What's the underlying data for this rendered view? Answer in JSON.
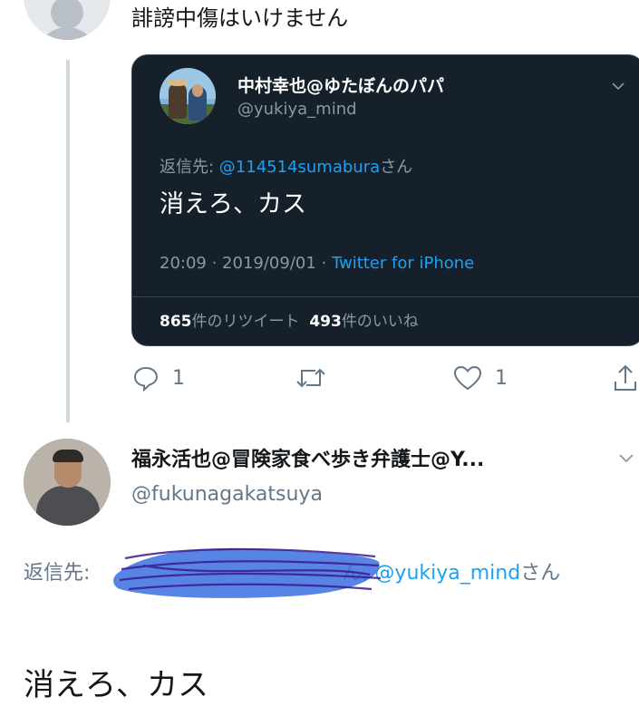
{
  "tweet1": {
    "text": "誹謗中傷はいけません",
    "avatar": "default-profile-avatar"
  },
  "quoted": {
    "display_name": "中村幸也@ゆたぼんのパパ",
    "handle": "@yukiya_mind",
    "reply_label": "返信先: ",
    "reply_mention": "@114514sumabura",
    "reply_suffix": "さん",
    "text": "消えろ、カス",
    "time": "20:09 · 2019/09/01 · ",
    "source": "Twitter for iPhone",
    "retweets_count": "865",
    "retweets_label": "件のリツイート",
    "likes_count": "493",
    "likes_label": "件のいいね",
    "colors": {
      "background": "#15202b",
      "accent": "#1da1f2",
      "muted": "#8899a6"
    }
  },
  "actions": {
    "reply_count": "1",
    "like_count": "1",
    "icons": [
      "reply-icon",
      "retweet-icon",
      "like-icon",
      "share-icon"
    ]
  },
  "tweet2": {
    "display_name": "福永活也@冒険家食べ歩き弁護士@Y...",
    "handle": "@fukunagakatsuya",
    "reply_label": "返信先:",
    "reply_redacted_suffix": "ん, ",
    "reply_mention": "@yukiya_mind",
    "reply_suffix": "さん",
    "text": "消えろ、カス"
  }
}
